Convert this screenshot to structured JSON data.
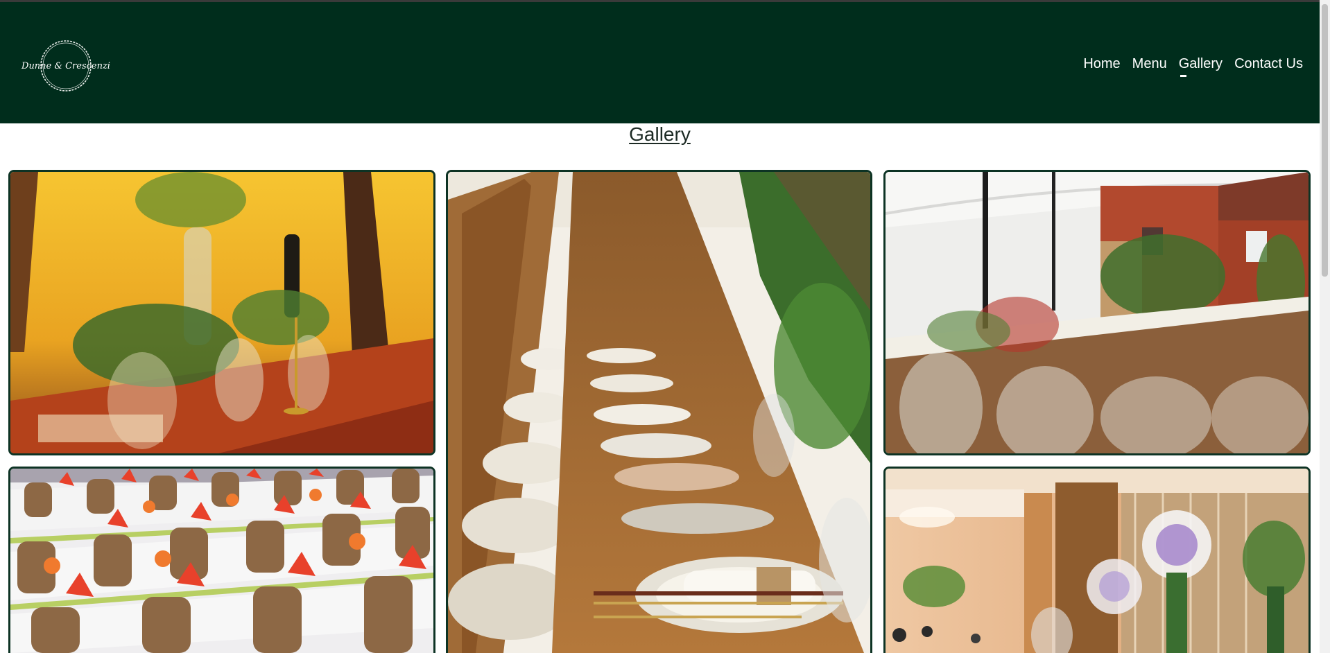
{
  "header": {
    "logo_text": "Dunne & Crescenzi",
    "nav": [
      {
        "label": "Home",
        "active": false
      },
      {
        "label": "Menu",
        "active": false
      },
      {
        "label": "Gallery",
        "active": true
      },
      {
        "label": "Contact Us",
        "active": false
      }
    ]
  },
  "page": {
    "title": "Gallery"
  },
  "gallery": {
    "images": [
      {
        "name": "tent-table-setting-photo",
        "subject": "wine bottles, glassware and greenery on a table in a yellow-lit tent"
      },
      {
        "name": "long-table-place-settings-photo",
        "subject": "long rustic wooden table with plates, napkins, cutlery and ferns"
      },
      {
        "name": "courtyard-marquee-tables-photo",
        "subject": "courtyard marquee with banquet tables beside a brick building"
      },
      {
        "name": "banquet-hall-orange-napkins-photo",
        "subject": "rows of white-clothed tables with orange napkins and wooden chairs"
      },
      {
        "name": "floral-venue-hall-photo",
        "subject": "hall with tall white and purple floral arrangements"
      }
    ]
  },
  "colors": {
    "header_bg": "#002d1c",
    "tile_border": "#0d3324",
    "nav_text": "#ffffff",
    "title_text": "#1c2a24"
  }
}
